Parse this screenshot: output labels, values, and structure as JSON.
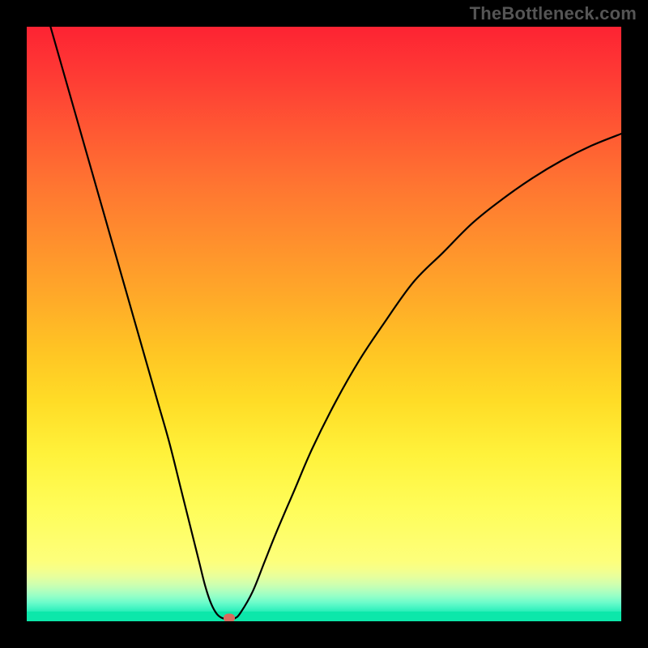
{
  "watermark": "TheBottleneck.com",
  "chart_data": {
    "type": "line",
    "title": "",
    "xlabel": "",
    "ylabel": "",
    "xlim": [
      0,
      100
    ],
    "ylim": [
      0,
      100
    ],
    "grid": false,
    "legend": false,
    "background_gradient": {
      "top_color": "#fd2333",
      "mid_color": "#fff23b",
      "bottom_color": "#0ce7aa"
    },
    "series": [
      {
        "name": "bottleneck-curve",
        "x": [
          4,
          6,
          8,
          10,
          12,
          14,
          16,
          18,
          20,
          22,
          24,
          26,
          28,
          29,
          30,
          31,
          32,
          33,
          34,
          35,
          36,
          38,
          40,
          42,
          45,
          48,
          52,
          56,
          60,
          65,
          70,
          75,
          80,
          85,
          90,
          95,
          100
        ],
        "y": [
          100,
          93,
          86,
          79,
          72,
          65,
          58,
          51,
          44,
          37,
          30,
          22,
          14,
          10,
          6,
          3,
          1.2,
          0.5,
          0.5,
          0.5,
          1.5,
          5,
          10,
          15,
          22,
          29,
          37,
          44,
          50,
          57,
          62,
          67,
          71,
          74.5,
          77.5,
          80,
          82
        ]
      }
    ],
    "annotations": [
      {
        "name": "min-marker",
        "x": 34,
        "y": 0.5,
        "color": "#d86b5e",
        "shape": "oval"
      }
    ]
  }
}
